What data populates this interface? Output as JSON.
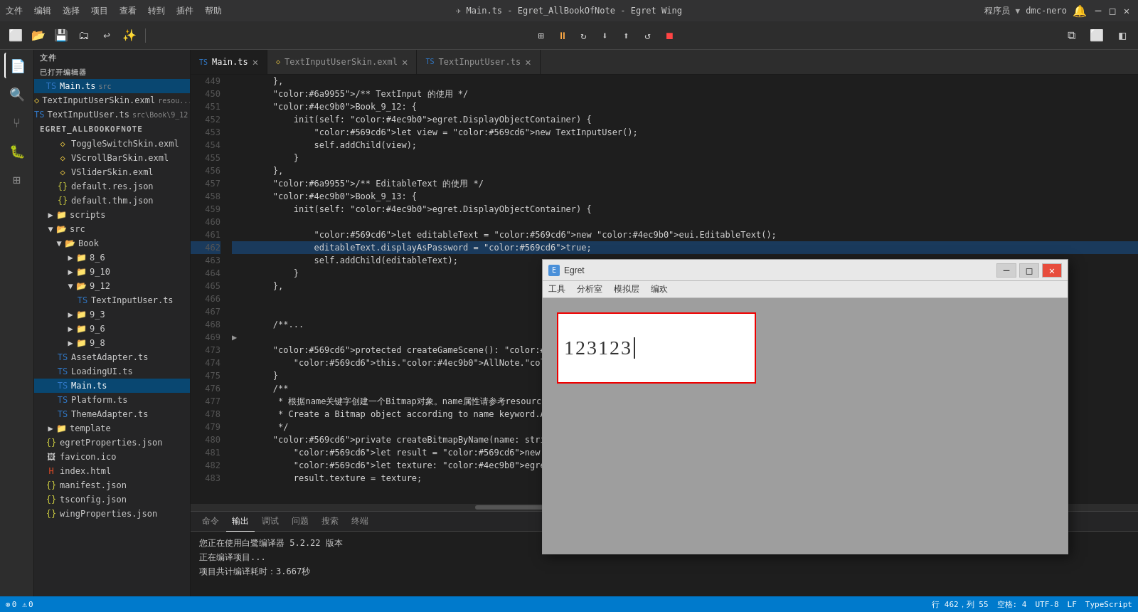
{
  "titleBar": {
    "menu": [
      "文件",
      "编辑",
      "选择",
      "项目",
      "查看",
      "转到",
      "插件",
      "帮助"
    ],
    "title": "Main.ts - Egret_AllBookOfNote - Egret Wing",
    "userLabel": "程序员",
    "userName": "dmc-nero",
    "controls": [
      "─",
      "□",
      "✕"
    ]
  },
  "toolbar": {
    "buttons": [
      "new",
      "open",
      "save",
      "saveAll",
      "undo",
      "redo"
    ],
    "debugButtons": [
      "grid",
      "pause",
      "refresh",
      "stepOver",
      "stepInto",
      "restart",
      "stop"
    ]
  },
  "activityBar": {
    "items": [
      "explorer",
      "search",
      "git",
      "debug",
      "extensions"
    ]
  },
  "sidebar": {
    "openFiles": {
      "title": "已打开编辑器",
      "files": [
        {
          "name": "Main.ts",
          "tag": "src",
          "type": "ts",
          "active": true
        },
        {
          "name": "TextInputUserSkin.exml",
          "tag": "resou...",
          "type": "exml"
        },
        {
          "name": "TextInputUser.ts",
          "tag": "src\\Book\\9_12",
          "type": "ts"
        }
      ]
    },
    "project": {
      "title": "EGRET_ALLBOOKOFNOTE",
      "items": [
        {
          "name": "ToggleSwitchSkin.exml",
          "type": "exml",
          "indent": 2
        },
        {
          "name": "VScrollBarSkin.exml",
          "type": "exml",
          "indent": 2
        },
        {
          "name": "VSliderSkin.exml",
          "type": "exml",
          "indent": 2
        },
        {
          "name": "default.res.json",
          "type": "json",
          "indent": 2
        },
        {
          "name": "default.thm.json",
          "type": "json",
          "indent": 2
        },
        {
          "name": "scripts",
          "type": "folder",
          "indent": 1
        },
        {
          "name": "src",
          "type": "folder",
          "indent": 1,
          "expanded": true
        },
        {
          "name": "Book",
          "type": "folder",
          "indent": 2,
          "expanded": true
        },
        {
          "name": "8_6",
          "type": "folder",
          "indent": 3
        },
        {
          "name": "9_10",
          "type": "folder",
          "indent": 3
        },
        {
          "name": "9_12",
          "type": "folder",
          "indent": 3,
          "expanded": true
        },
        {
          "name": "TextInputUser.ts",
          "type": "ts",
          "indent": 4
        },
        {
          "name": "9_3",
          "type": "folder",
          "indent": 3
        },
        {
          "name": "9_6",
          "type": "folder",
          "indent": 3
        },
        {
          "name": "9_8",
          "type": "folder",
          "indent": 3
        },
        {
          "name": "AssetAdapter.ts",
          "type": "ts",
          "indent": 2
        },
        {
          "name": "LoadingUI.ts",
          "type": "ts",
          "indent": 2
        },
        {
          "name": "Main.ts",
          "type": "ts",
          "indent": 2,
          "active": true
        },
        {
          "name": "Platform.ts",
          "type": "ts",
          "indent": 2
        },
        {
          "name": "ThemeAdapter.ts",
          "type": "ts",
          "indent": 2
        },
        {
          "name": "template",
          "type": "folder",
          "indent": 1
        },
        {
          "name": "egretProperties.json",
          "type": "json",
          "indent": 1
        },
        {
          "name": "favicon.ico",
          "type": "ico",
          "indent": 1
        },
        {
          "name": "index.html",
          "type": "html",
          "indent": 1
        },
        {
          "name": "manifest.json",
          "type": "json",
          "indent": 1
        },
        {
          "name": "tsconfig.json",
          "type": "json",
          "indent": 1
        },
        {
          "name": "wingProperties.json",
          "type": "json",
          "indent": 1
        }
      ]
    }
  },
  "editor": {
    "tabs": [
      {
        "name": "Main.ts",
        "active": true,
        "icon": "ts"
      },
      {
        "name": "TextInputUserSkin.exml",
        "active": false,
        "icon": "exml"
      },
      {
        "name": "TextInputUser.ts",
        "active": false,
        "icon": "ts"
      }
    ],
    "lines": [
      {
        "num": 449,
        "code": "        },"
      },
      {
        "num": 450,
        "code": "        /** TextInput 的使用 */"
      },
      {
        "num": 451,
        "code": "        Book_9_12: {"
      },
      {
        "num": 452,
        "code": "            init(self: egret.DisplayObjectContainer) {"
      },
      {
        "num": 453,
        "code": "                let view = new TextInputUser();"
      },
      {
        "num": 454,
        "code": "                self.addChild(view);"
      },
      {
        "num": 455,
        "code": "            }"
      },
      {
        "num": 456,
        "code": "        },"
      },
      {
        "num": 457,
        "code": "        /** EditableText 的使用 */"
      },
      {
        "num": 458,
        "code": "        Book_9_13: {"
      },
      {
        "num": 459,
        "code": "            init(self: egret.DisplayObjectContainer) {"
      },
      {
        "num": 460,
        "code": ""
      },
      {
        "num": 461,
        "code": "                let editableText = new eui.EditableText();"
      },
      {
        "num": 462,
        "code": "                editableText.displayAsPassword = true;"
      },
      {
        "num": 463,
        "code": "                self.addChild(editableText);"
      },
      {
        "num": 464,
        "code": "            }"
      },
      {
        "num": 465,
        "code": "        },"
      },
      {
        "num": 466,
        "code": ""
      },
      {
        "num": 467,
        "code": ""
      },
      {
        "num": 468,
        "code": "        /**..."
      },
      {
        "num": 469,
        "code": "▶"
      },
      {
        "num": 473,
        "code": "        protected createGameScene(): void {"
      },
      {
        "num": 474,
        "code": "            this.AllNote.Book_9_13.init(this);"
      },
      {
        "num": 475,
        "code": "        }"
      },
      {
        "num": 476,
        "code": "        /**"
      },
      {
        "num": 477,
        "code": "         * 根据name关键字创建一个Bitmap对象。name属性请参考resources/resou"
      },
      {
        "num": 478,
        "code": "         * Create a Bitmap object according to name keyword.As for the"
      },
      {
        "num": 479,
        "code": "         */"
      },
      {
        "num": 480,
        "code": "        private createBitmapByName(name: string): egret.Bitmap {"
      },
      {
        "num": 481,
        "code": "            let result = new egret.Bitmap();"
      },
      {
        "num": 482,
        "code": "            let texture: egret.Texture = RES.getRes(name);"
      },
      {
        "num": 483,
        "code": "            result.texture = texture;"
      }
    ]
  },
  "bottomPanel": {
    "tabs": [
      "命令",
      "输出",
      "调试",
      "问题",
      "搜索",
      "终端"
    ],
    "activeTab": "输出",
    "content": [
      "您正在使用白鹭编译器 5.2.22 版本",
      "正在编译项目...",
      "项目共计编译耗时：3.667秒"
    ]
  },
  "statusBar": {
    "errors": "0",
    "warnings": "0",
    "position": "行 462，列 55",
    "spaces": "空格: 4",
    "encoding": "UTF-8",
    "lineEnding": "LF",
    "language": "TypeScript"
  },
  "egretWindow": {
    "title": "Egret",
    "menu": [
      "工具",
      "分析室",
      "模拟层",
      "编欢"
    ],
    "inputValue": "123123"
  }
}
